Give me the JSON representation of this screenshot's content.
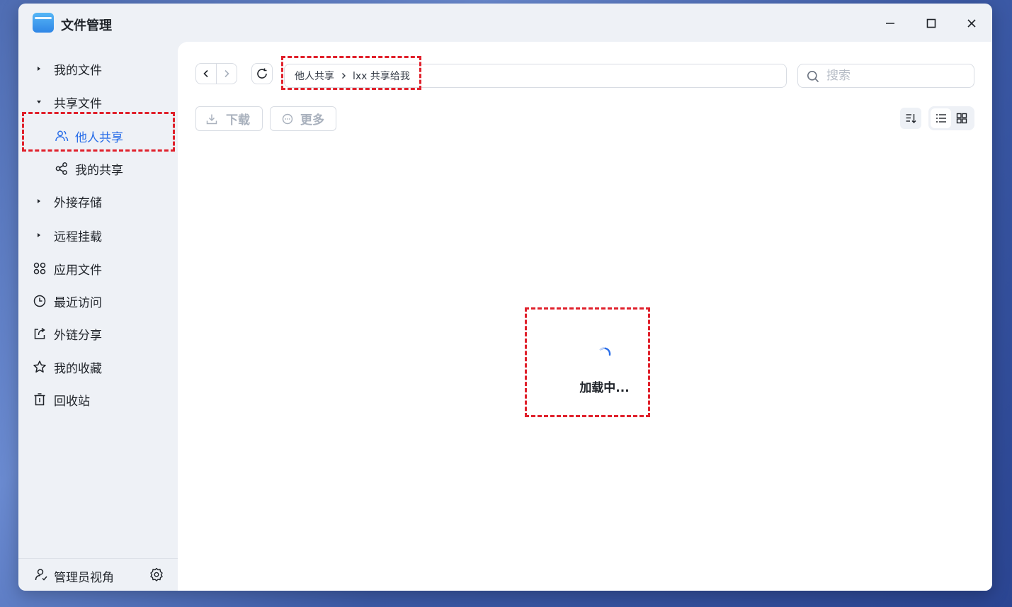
{
  "window": {
    "title": "文件管理",
    "controls": [
      "minimize",
      "maximize",
      "close"
    ]
  },
  "sidebar": {
    "items": [
      {
        "label": "我的文件",
        "icon": "caret-right-icon",
        "expanded": false
      },
      {
        "label": "共享文件",
        "icon": "caret-down-icon",
        "expanded": true,
        "children": [
          {
            "label": "他人共享",
            "icon": "users-icon",
            "active": true
          },
          {
            "label": "我的共享",
            "icon": "share-nodes-icon",
            "active": false
          }
        ]
      },
      {
        "label": "外接存储",
        "icon": "caret-right-icon",
        "expanded": false
      },
      {
        "label": "远程挂载",
        "icon": "caret-right-icon",
        "expanded": false
      },
      {
        "label": "应用文件",
        "icon": "apps-icon"
      },
      {
        "label": "最近访问",
        "icon": "clock-icon"
      },
      {
        "label": "外链分享",
        "icon": "external-share-icon"
      },
      {
        "label": "我的收藏",
        "icon": "star-icon"
      },
      {
        "label": "回收站",
        "icon": "trash-icon"
      }
    ],
    "footer": {
      "label": "管理员视角",
      "icon": "admin-user-icon",
      "settings_icon": "gear-icon"
    }
  },
  "toolbar": {
    "breadcrumb": [
      "他人共享",
      "lxx 共享给我"
    ],
    "search": {
      "placeholder": "搜索",
      "value": ""
    },
    "download_label": "下载",
    "more_label": "更多",
    "view_mode": "list"
  },
  "content": {
    "loading_text": "加载中..."
  },
  "colors": {
    "accent": "#2a6ee8",
    "annotation": "#e0202b",
    "sidebar_bg": "#eef1f6"
  }
}
